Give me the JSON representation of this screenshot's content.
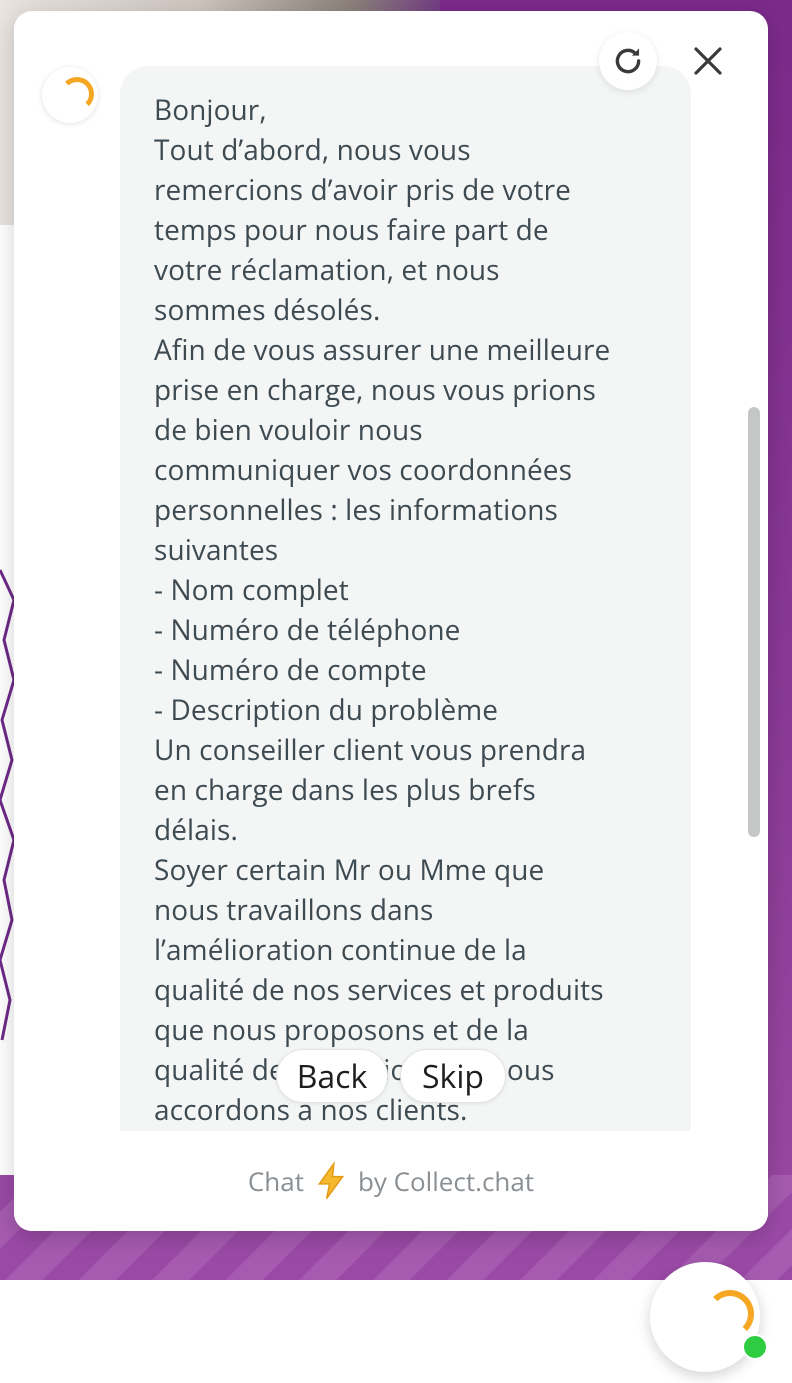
{
  "chat": {
    "message_lines": [
      "Bonjour,",
      "Tout d’abord, nous vous",
      "remercions d’avoir pris de votre",
      "temps pour nous faire part de",
      "votre réclamation, et nous",
      "sommes désolés.",
      "Afin de vous assurer une meilleure",
      "prise en charge, nous vous prions",
      "de bien vouloir nous",
      "communiquer vos coordonnées",
      "personnelles : les informations",
      "suivantes",
      "- Nom complet",
      "- Numéro de téléphone",
      "- Numéro de compte",
      "- Description du problème",
      "Un conseiller client vous prendra",
      "en charge dans les plus brefs",
      "délais.",
      "Soyer certain Mr ou Mme que",
      "nous travaillons dans",
      "l’amélioration continue de la",
      "qualité de nos services et produits",
      "que nous proposons et de la",
      "qualité de l’attention que nous",
      "accordons à nos clients."
    ],
    "back_label": "Back",
    "skip_label": "Skip"
  },
  "footer": {
    "prefix": "Chat",
    "suffix": "by Collect.chat"
  },
  "icons": {
    "restart": "refresh-icon",
    "close": "close-icon",
    "bolt": "lightning-bolt-icon"
  },
  "colors": {
    "bubble_bg": "#f4f6f5",
    "message_text": "#3e4a52",
    "brand_purple": "#7b2a8a",
    "accent_orange": "#f5a623",
    "online_green": "#2ecc40"
  }
}
